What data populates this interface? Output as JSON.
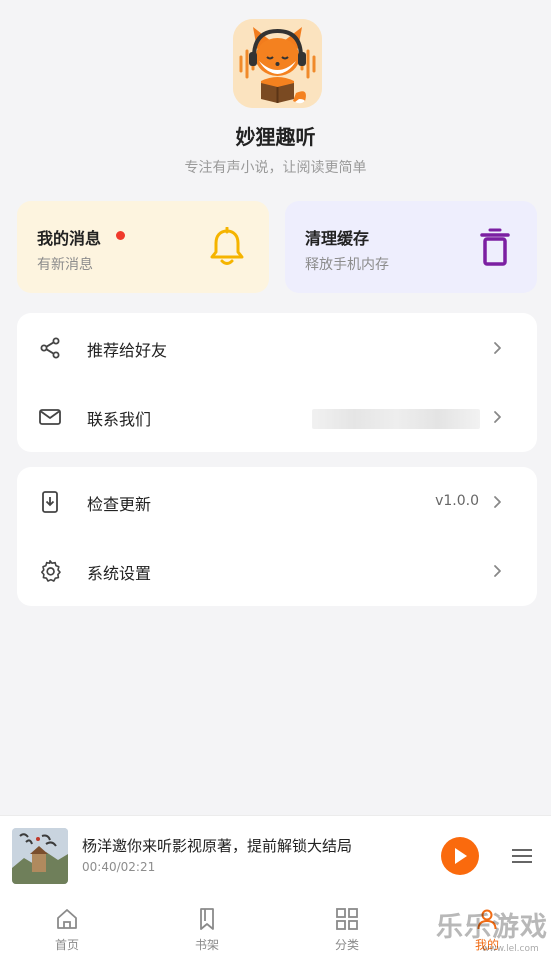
{
  "header": {
    "app_name": "妙狸趣听",
    "slogan": "专注有声小说，让阅读更简单",
    "logo_icon": "fox-reading-book-with-headphones-icon"
  },
  "quick_cards": {
    "messages": {
      "title": "我的消息",
      "subtitle": "有新消息",
      "icon": "bell-icon",
      "unread": true,
      "accent": "#f5b400",
      "background": "#fdf4df"
    },
    "cache": {
      "title": "清理缓存",
      "subtitle": "释放手机内存",
      "icon": "trash-icon",
      "accent": "#7b1fa2",
      "background": "#eeeefd"
    }
  },
  "menu": {
    "group1": [
      {
        "label": "推荐给好友",
        "icon": "share-icon"
      },
      {
        "label": "联系我们",
        "icon": "mail-icon"
      }
    ],
    "group2": [
      {
        "label": "检查更新",
        "icon": "download-update-icon",
        "value": "v1.0.0"
      },
      {
        "label": "系统设置",
        "icon": "gear-icon"
      }
    ]
  },
  "player": {
    "title": "杨洋邀你来听影视原著，提前解锁大结局",
    "time": "00:40/02:21",
    "accent": "#fa6a0d"
  },
  "tabs": [
    {
      "label": "首页",
      "icon": "home-icon"
    },
    {
      "label": "书架",
      "icon": "bookmark-icon"
    },
    {
      "label": "分类",
      "icon": "grid-icon"
    },
    {
      "label": "我的",
      "icon": "profile-icon",
      "active": true
    }
  ],
  "watermark": {
    "text": "乐乐游戏",
    "sub": "www.lel.com"
  }
}
